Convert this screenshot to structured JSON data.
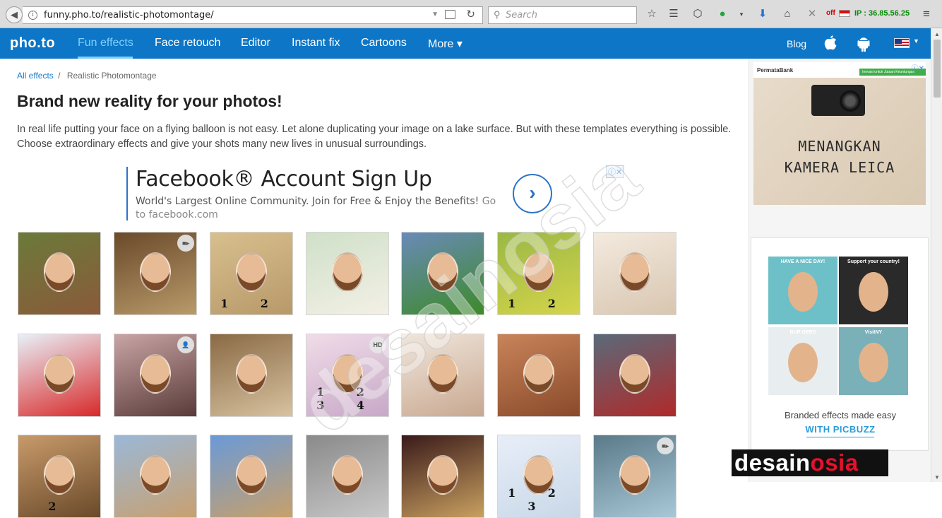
{
  "browser": {
    "url": "funny.pho.to/realistic-photomontage/",
    "search_placeholder": "Search",
    "off_label": "off",
    "ip_label": "IP : 36.85.56.25",
    "icons": [
      "back-arrow-icon",
      "info-icon",
      "reader-view-icon",
      "reload-icon",
      "search-icon",
      "star-icon",
      "reading-list-icon",
      "pocket-icon",
      "whatsapp-icon",
      "download-icon",
      "home-icon",
      "close-x-icon",
      "indonesia-flag-icon",
      "hamburger-menu-icon"
    ]
  },
  "site_nav": {
    "logo": "pho.to",
    "items": [
      {
        "label": "Fun effects",
        "active": true
      },
      {
        "label": "Face retouch",
        "active": false
      },
      {
        "label": "Editor",
        "active": false
      },
      {
        "label": "Instant fix",
        "active": false
      },
      {
        "label": "Cartoons",
        "active": false
      },
      {
        "label": "More ▾",
        "active": false
      }
    ],
    "blog": "Blog",
    "colors": {
      "bar": "#0d76c6",
      "active": "#7fd0ff"
    }
  },
  "breadcrumb": {
    "link": "All effects",
    "separator": "/",
    "current": "Realistic Photomontage"
  },
  "page": {
    "title": "Brand new reality for your photos!",
    "description": "In real life putting your face on a flying balloon is not easy. Let alone duplicating your image on a lake surface. But with these templates everything is possible. Choose extraordinary effects and give your shots many new lives in unusual surroundings."
  },
  "ad_facebook": {
    "title": "Facebook® Account Sign Up",
    "body": "World's Largest Online Community. Join for Free & Enjoy the Benefits!",
    "goto": "Go to facebook.com",
    "choices": "ⓘ✕"
  },
  "effects": [
    {
      "name": "graffiti-wall",
      "colors": [
        "#6b7a3a",
        "#8a5a3a"
      ],
      "badge": "",
      "nums": ""
    },
    {
      "name": "old-book",
      "colors": [
        "#6a4a2a",
        "#b89a6a"
      ],
      "badge": "video",
      "nums": ""
    },
    {
      "name": "sand-heart",
      "colors": [
        "#d8bf8e",
        "#b8996a"
      ],
      "badge": "",
      "nums": "1 2"
    },
    {
      "name": "phone-selfie",
      "colors": [
        "#cfe0c8",
        "#f3f0e6"
      ],
      "badge": "",
      "nums": ""
    },
    {
      "name": "football-stadium",
      "colors": [
        "#6a8ab8",
        "#3d8a2a"
      ],
      "badge": "",
      "nums": ""
    },
    {
      "name": "clothesline-photos",
      "colors": [
        "#9ab845",
        "#d4d44a"
      ],
      "badge": "",
      "nums": "1 2"
    },
    {
      "name": "knit-heart",
      "colors": [
        "#f3eadf",
        "#d8c6b0"
      ],
      "badge": "",
      "nums": ""
    },
    {
      "name": "birthday-balloon",
      "colors": [
        "#e8f0f8",
        "#d82a2a"
      ],
      "badge": "",
      "nums": ""
    },
    {
      "name": "eye-reflection",
      "colors": [
        "#c9a5a5",
        "#5a3a3a"
      ],
      "badge": "person",
      "nums": ""
    },
    {
      "name": "vintage-frame",
      "colors": [
        "#8a6a45",
        "#d8c2a0"
      ],
      "badge": "",
      "nums": ""
    },
    {
      "name": "photo-collage",
      "colors": [
        "#f0dce8",
        "#c8a8c8"
      ],
      "badge": "HD",
      "nums": "1 2 3 4"
    },
    {
      "name": "flower-frame",
      "colors": [
        "#f0e6dc",
        "#c8a890"
      ],
      "badge": "",
      "nums": ""
    },
    {
      "name": "coffee-cup",
      "colors": [
        "#c8845a",
        "#8a4a2a"
      ],
      "badge": "",
      "nums": ""
    },
    {
      "name": "london-bus",
      "colors": [
        "#5a6a7a",
        "#b02a2a"
      ],
      "badge": "",
      "nums": ""
    },
    {
      "name": "couple-frame",
      "colors": [
        "#c89a6a",
        "#6a4a2a"
      ],
      "badge": "",
      "nums": "2"
    },
    {
      "name": "wooden-frame",
      "colors": [
        "#9ab8d8",
        "#c8a070"
      ],
      "badge": "",
      "nums": ""
    },
    {
      "name": "wanted-poster",
      "colors": [
        "#6a9ad8",
        "#c8a06a"
      ],
      "badge": "",
      "nums": ""
    },
    {
      "name": "mirror-kaleidoscope",
      "colors": [
        "#8a8a8a",
        "#c8c8c8"
      ],
      "badge": "",
      "nums": ""
    },
    {
      "name": "scroll-roses",
      "colors": [
        "#3a1a1a",
        "#c8a060"
      ],
      "badge": "",
      "nums": ""
    },
    {
      "name": "kids-bubbles",
      "colors": [
        "#e8eef8",
        "#c8d8e8"
      ],
      "badge": "",
      "nums": "1 2 3"
    },
    {
      "name": "waterfall",
      "colors": [
        "#5a7a8a",
        "#a8c8d8"
      ],
      "badge": "video",
      "nums": ""
    }
  ],
  "sidebar": {
    "ad_leica": {
      "brand": "PermataBank",
      "strip": "Inovasi untuk Jutaan Keuntungan",
      "headline": "MENANGKAN\nKAMERA LEICA"
    },
    "ad_picbuzz": {
      "tiles": [
        {
          "name": "have-a-nice-day",
          "color": "#6ec0c8"
        },
        {
          "name": "support-your-country",
          "color": "#2a2a2a"
        },
        {
          "name": "burgers",
          "color": "#e8eef0"
        },
        {
          "name": "statue-of-liberty",
          "color": "#7ab0b8"
        }
      ],
      "tile_texts": [
        "HAVE A NICE DAY!",
        "Support your country!",
        "BUR GERS",
        "VisitNY"
      ],
      "caption": "Branded effects made easy",
      "link": "WITH PICBUZZ"
    }
  },
  "watermark": "desainosia",
  "brand_mark": {
    "part1": "desain",
    "part2": "osia"
  }
}
